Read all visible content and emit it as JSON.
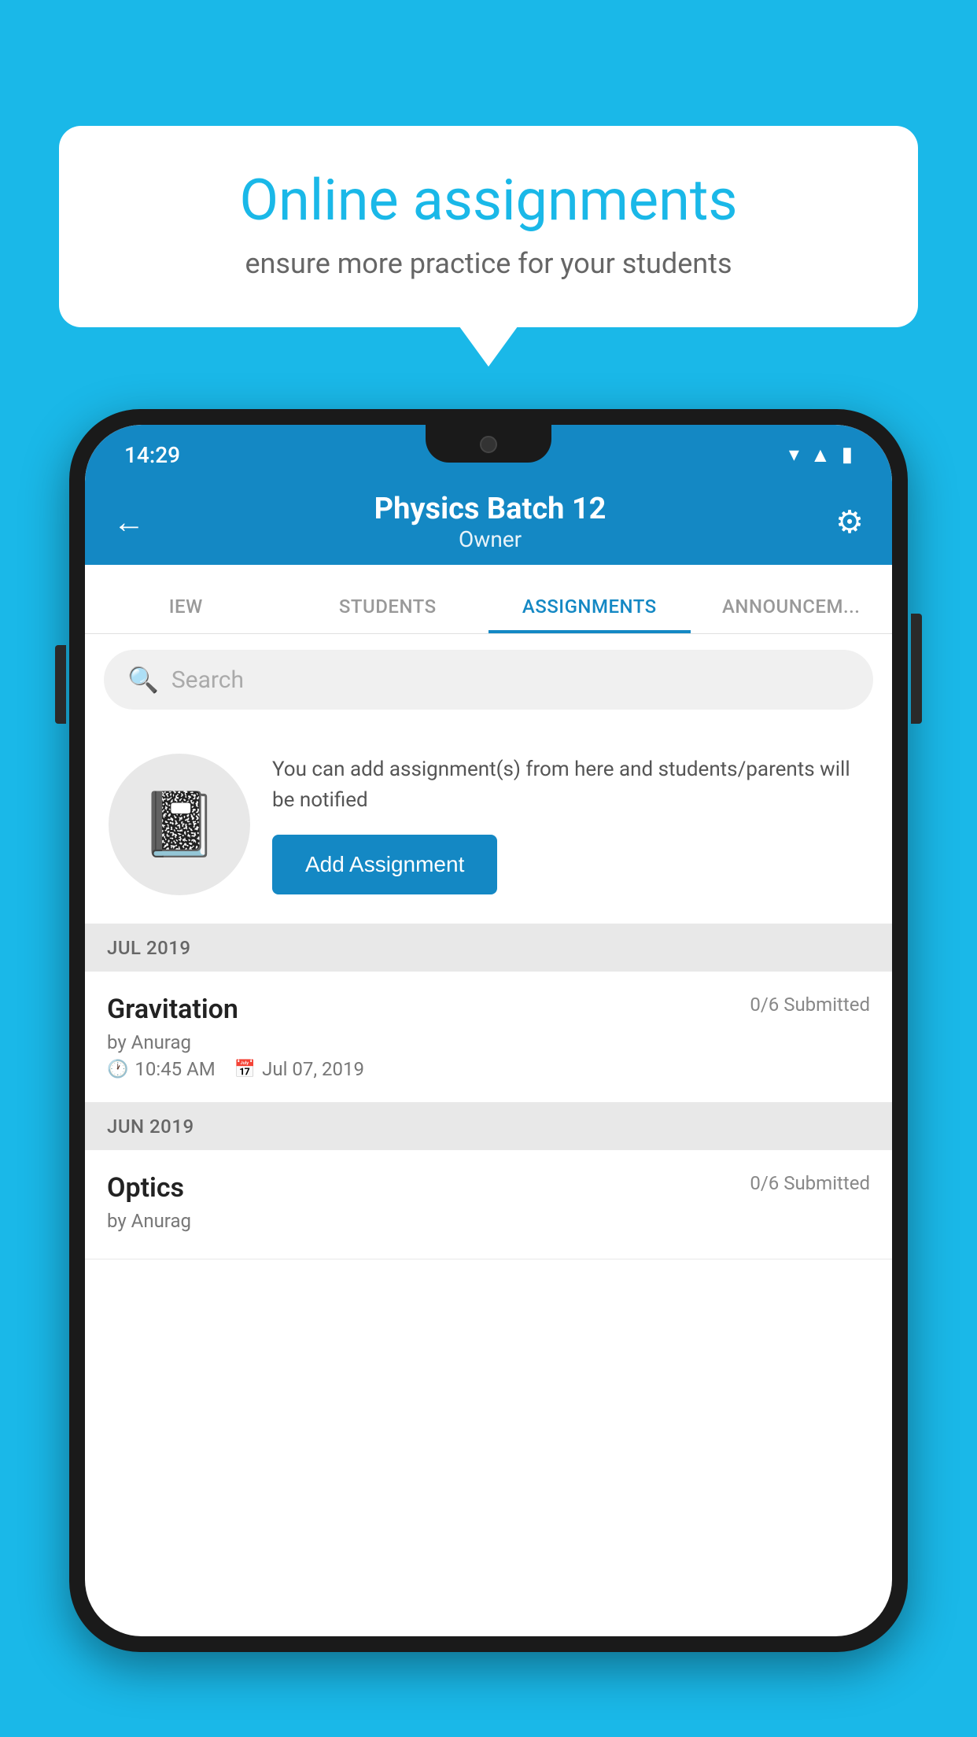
{
  "background_color": "#1ab8e8",
  "speech_bubble": {
    "title": "Online assignments",
    "subtitle": "ensure more practice for your students"
  },
  "status_bar": {
    "time": "14:29",
    "icons": [
      "wifi",
      "signal",
      "battery"
    ]
  },
  "app_bar": {
    "title": "Physics Batch 12",
    "subtitle": "Owner",
    "back_label": "←",
    "settings_label": "⚙"
  },
  "tabs": [
    {
      "label": "IEW",
      "active": false
    },
    {
      "label": "STUDENTS",
      "active": false
    },
    {
      "label": "ASSIGNMENTS",
      "active": true
    },
    {
      "label": "ANNOUNCEM...",
      "active": false
    }
  ],
  "search": {
    "placeholder": "Search"
  },
  "promo": {
    "description": "You can add assignment(s) from here and students/parents will be notified",
    "button_label": "Add Assignment"
  },
  "sections": [
    {
      "month": "JUL 2019",
      "assignments": [
        {
          "title": "Gravitation",
          "submitted": "0/6 Submitted",
          "by": "by Anurag",
          "time": "10:45 AM",
          "date": "Jul 07, 2019"
        }
      ]
    },
    {
      "month": "JUN 2019",
      "assignments": [
        {
          "title": "Optics",
          "submitted": "0/6 Submitted",
          "by": "by Anurag",
          "time": "",
          "date": ""
        }
      ]
    }
  ]
}
